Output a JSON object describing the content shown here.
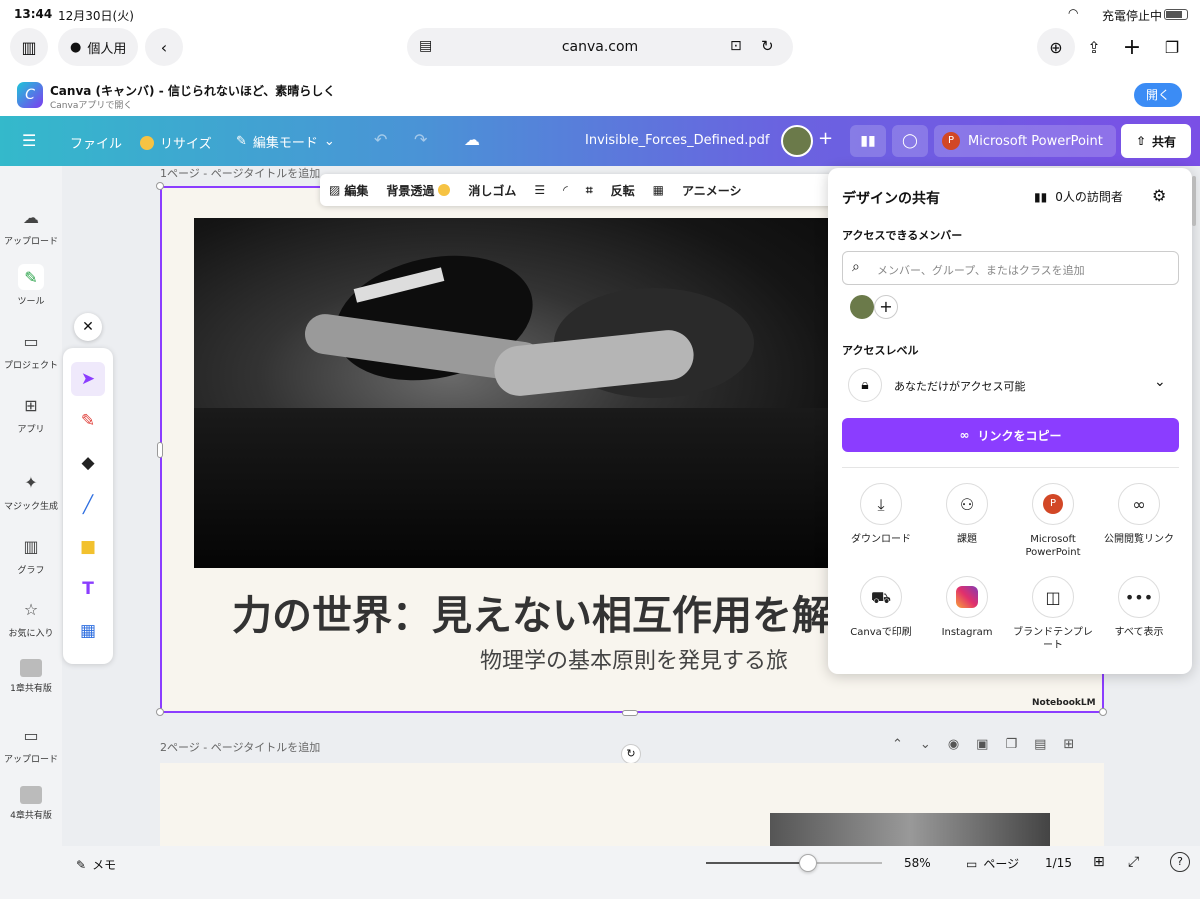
{
  "status": {
    "time": "13:44",
    "date": "12月30日(火)",
    "battery": "充電停止中"
  },
  "safari": {
    "profile": "個人用",
    "url": "canva.com"
  },
  "banner": {
    "title": "Canva (キャンバ) - 信じられないほど、素晴らしく",
    "subtitle": "Canvaアプリで開く",
    "open": "開く"
  },
  "canvabar": {
    "file": "ファイル",
    "resize": "リサイズ",
    "mode": "編集モード",
    "filename": "Invisible_Forces_Defined.pdf",
    "ppt": "Microsoft PowerPoint",
    "share": "共有"
  },
  "sidebar": {
    "items": [
      "アップロード",
      "ツール",
      "プロジェクト",
      "アプリ",
      "マジック生成",
      "グラフ",
      "お気に入り",
      "1章共有版",
      "アップロード",
      "4章共有版"
    ]
  },
  "edit_toolbar": {
    "edit": "編集",
    "bg_remove": "背景透過",
    "eraser": "消しゴム",
    "flip": "反転",
    "animate": "アニメーシ"
  },
  "page1": {
    "label": "1ページ - ページタイトルを追加",
    "title": "力の世界：見えない相互作用を解",
    "subtitle": "物理学の基本原則を発見する旅",
    "badge": "NotebookLM"
  },
  "page2": {
    "label": "2ページ - ページタイトルを追加"
  },
  "share": {
    "title": "デザインの共有",
    "visitors": "0人の訪問者",
    "members_label": "アクセスできるメンバー",
    "search_placeholder": "メンバー、グループ、またはクラスを追加",
    "access_label": "アクセスレベル",
    "access_value": "あなただけがアクセス可能",
    "copy_link": "リンクをコピー",
    "options": [
      {
        "label": "ダウンロード",
        "icon": "download-icon"
      },
      {
        "label": "課題",
        "icon": "assignment-icon"
      },
      {
        "label": "Microsoft PowerPoint",
        "icon": "powerpoint-icon"
      },
      {
        "label": "公開閲覧リンク",
        "icon": "link-icon"
      },
      {
        "label": "Canvaで印刷",
        "icon": "truck-icon"
      },
      {
        "label": "Instagram",
        "icon": "instagram-icon"
      },
      {
        "label": "ブランドテンプレート",
        "icon": "template-icon"
      },
      {
        "label": "すべて表示",
        "icon": "more-icon"
      }
    ]
  },
  "bottom": {
    "notes": "メモ",
    "zoom": "58%",
    "pages": "ページ",
    "page_count": "1/15",
    "zoom_level": 0.58
  },
  "colors": {
    "accent": "#8b3dff",
    "open_btn": "#3b8cf5"
  }
}
